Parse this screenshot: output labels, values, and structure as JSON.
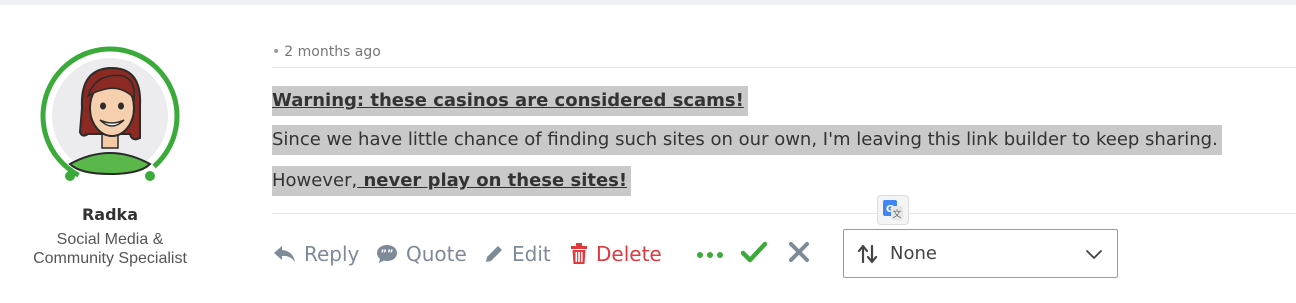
{
  "author": {
    "name": "Radka",
    "role_line1": "Social Media &",
    "role_line2": "Community Specialist",
    "ring_color": "#3aaa3a"
  },
  "post": {
    "timestamp": "2 months ago",
    "line1": "Warning: these casinos are considered scams!",
    "line2": "Since we have little chance of finding such sites on our own, I'm leaving this link builder to keep sharing.",
    "line3_prefix": "However,",
    "line3_link": " never play on these sites!",
    "highlight_color": "#c9c9c9"
  },
  "actions": {
    "reply": "Reply",
    "quote": "Quote",
    "edit": "Edit",
    "delete": "Delete",
    "accent_green": "#3aaa3a",
    "delete_color": "#e0393e"
  },
  "sort": {
    "selected": "None"
  }
}
